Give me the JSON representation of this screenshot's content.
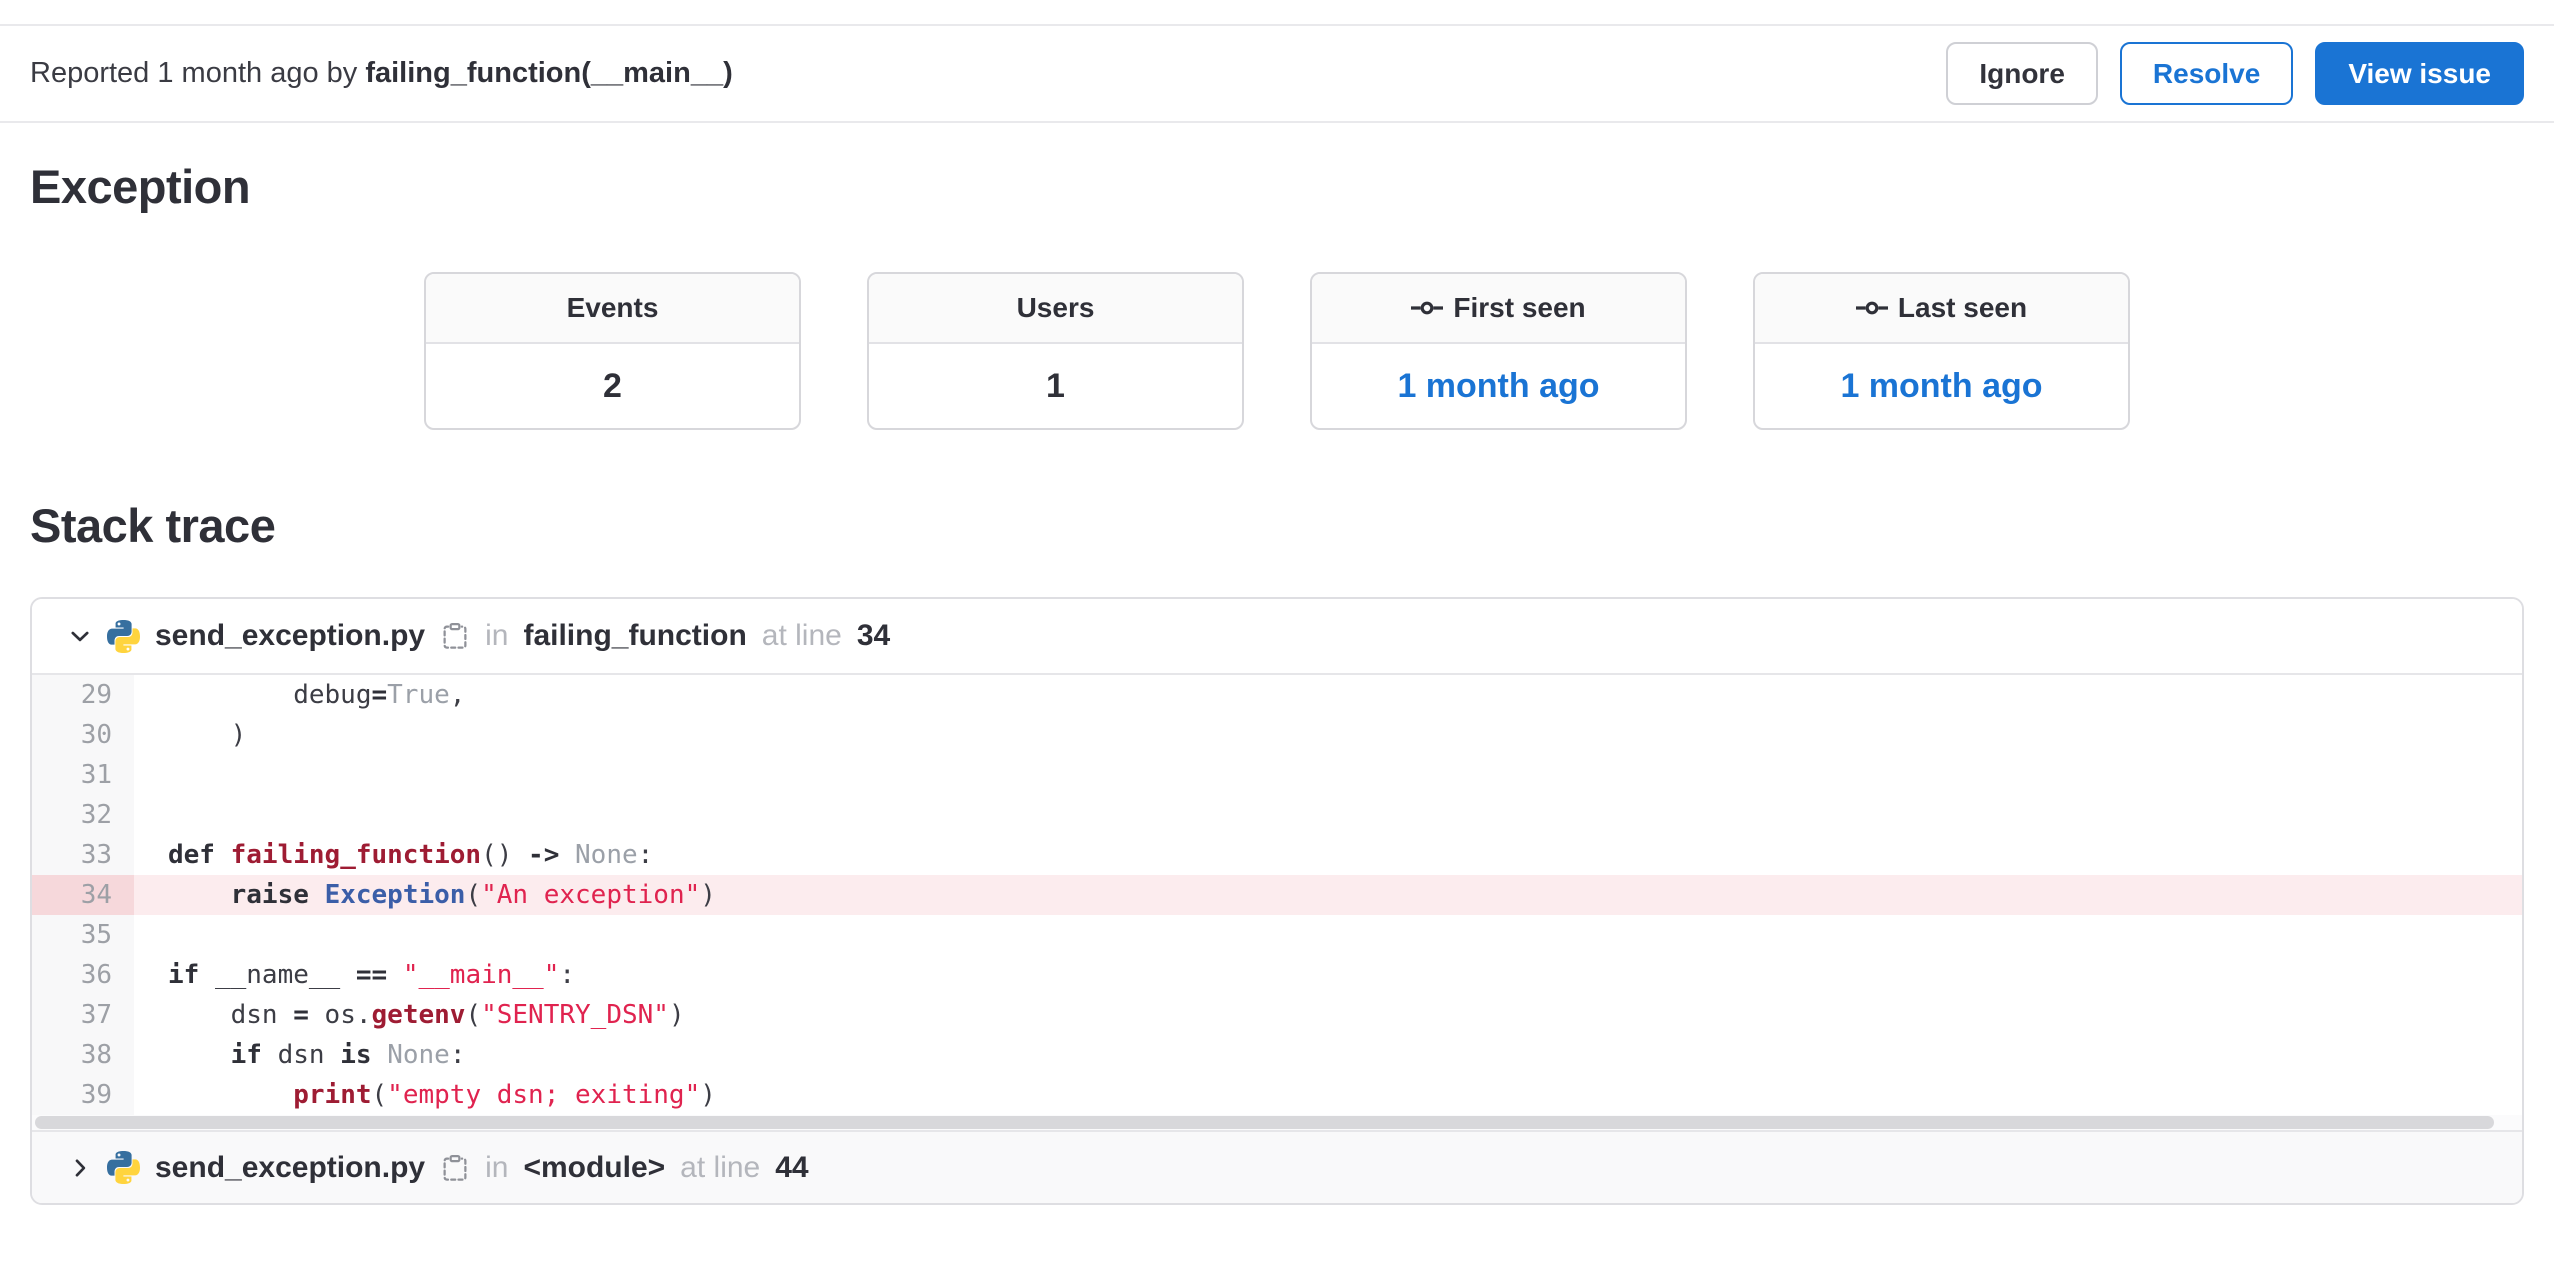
{
  "header": {
    "reported_prefix": "Reported 1 month ago by",
    "reported_by": "failing_function(__main__)",
    "buttons": [
      {
        "label": "Ignore"
      },
      {
        "label": "Resolve"
      },
      {
        "label": "View issue"
      }
    ]
  },
  "exception": {
    "title": "Exception",
    "stats": [
      {
        "label": "Events",
        "value": "2",
        "icon": null,
        "link": false
      },
      {
        "label": "Users",
        "value": "1",
        "icon": null,
        "link": false
      },
      {
        "label": "First seen",
        "value": "1 month ago",
        "icon": "commit-icon",
        "link": true
      },
      {
        "label": "Last seen",
        "value": "1 month ago",
        "icon": "commit-icon",
        "link": true
      }
    ]
  },
  "stack_trace": {
    "title": "Stack trace",
    "frames": [
      {
        "file": "send_exception.py",
        "in_label": "in",
        "function": "failing_function",
        "at_label": "at line",
        "line": "34",
        "expanded": true,
        "code": [
          {
            "no": "29",
            "hl": false,
            "tokens": [
              [
                "plain",
                "        debug"
              ],
              [
                "op",
                "="
              ],
              [
                "muted",
                "True"
              ],
              [
                "plain",
                ","
              ]
            ]
          },
          {
            "no": "30",
            "hl": false,
            "tokens": [
              [
                "plain",
                "    )"
              ]
            ]
          },
          {
            "no": "31",
            "hl": false,
            "tokens": []
          },
          {
            "no": "32",
            "hl": false,
            "tokens": []
          },
          {
            "no": "33",
            "hl": false,
            "tokens": [
              [
                "kw",
                "def"
              ],
              [
                "plain",
                " "
              ],
              [
                "fn",
                "failing_function"
              ],
              [
                "plain",
                "() "
              ],
              [
                "op",
                "->"
              ],
              [
                "plain",
                " "
              ],
              [
                "muted",
                "None"
              ],
              [
                "plain",
                ":"
              ]
            ]
          },
          {
            "no": "34",
            "hl": true,
            "tokens": [
              [
                "plain",
                "    "
              ],
              [
                "kw",
                "raise"
              ],
              [
                "plain",
                " "
              ],
              [
                "cls",
                "Exception"
              ],
              [
                "plain",
                "("
              ],
              [
                "str",
                "\"An exception\""
              ],
              [
                "plain",
                ")"
              ]
            ]
          },
          {
            "no": "35",
            "hl": false,
            "tokens": []
          },
          {
            "no": "36",
            "hl": false,
            "tokens": [
              [
                "kw",
                "if"
              ],
              [
                "plain",
                " __name__ "
              ],
              [
                "op",
                "=="
              ],
              [
                "plain",
                " "
              ],
              [
                "str",
                "\"__main__\""
              ],
              [
                "plain",
                ":"
              ]
            ]
          },
          {
            "no": "37",
            "hl": false,
            "tokens": [
              [
                "plain",
                "    dsn "
              ],
              [
                "op",
                "="
              ],
              [
                "plain",
                " os."
              ],
              [
                "fn",
                "getenv"
              ],
              [
                "plain",
                "("
              ],
              [
                "str",
                "\"SENTRY_DSN\""
              ],
              [
                "plain",
                ")"
              ]
            ]
          },
          {
            "no": "38",
            "hl": false,
            "tokens": [
              [
                "plain",
                "    "
              ],
              [
                "kw",
                "if"
              ],
              [
                "plain",
                " dsn "
              ],
              [
                "kw",
                "is"
              ],
              [
                "plain",
                " "
              ],
              [
                "muted",
                "None"
              ],
              [
                "plain",
                ":"
              ]
            ]
          },
          {
            "no": "39",
            "hl": false,
            "tokens": [
              [
                "plain",
                "        "
              ],
              [
                "fn",
                "print"
              ],
              [
                "plain",
                "("
              ],
              [
                "str",
                "\"empty dsn; exiting\""
              ],
              [
                "plain",
                ")"
              ]
            ]
          }
        ]
      },
      {
        "file": "send_exception.py",
        "in_label": "in",
        "function": "<module>",
        "at_label": "at line",
        "line": "44",
        "expanded": false
      }
    ]
  },
  "colors": {
    "accent_blue": "#1a74d4",
    "error_line_bg": "#fcecee",
    "error_gutter_bg": "#f6d8db",
    "string_red": "#e0234f",
    "function_red": "#9e1c33",
    "class_blue": "#3b5ea8",
    "python_blue": "#366f9f",
    "python_yellow": "#ffd43e"
  }
}
